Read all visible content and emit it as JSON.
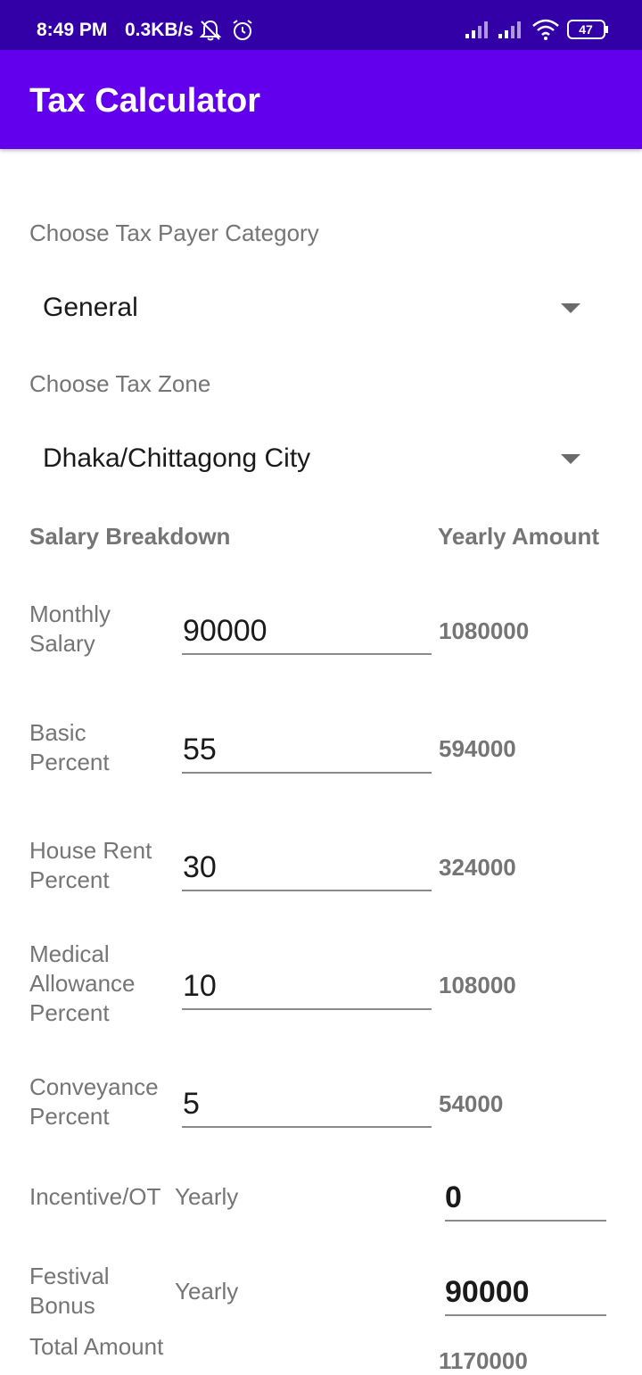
{
  "status_bar": {
    "time": "8:49 PM",
    "speed": "0.3KB/s",
    "battery": "47",
    "icons": [
      "dnd-bell-off-icon",
      "alarm-icon",
      "signal-icon",
      "signal-icon",
      "wifi-icon",
      "battery-icon"
    ]
  },
  "app_bar": {
    "title": "Tax Calculator"
  },
  "category": {
    "label": "Choose Tax Payer Category",
    "value": "General"
  },
  "zone": {
    "label": "Choose Tax Zone",
    "value": "Dhaka/Chittagong City"
  },
  "headers": {
    "breakdown": "Salary Breakdown",
    "yearly": "Yearly Amount"
  },
  "rows": [
    {
      "label_line1": "Monthly",
      "label_line2": "Salary",
      "label_line3": "",
      "value": "90000",
      "yearly": "1080000"
    },
    {
      "label_line1": "Basic",
      "label_line2": "Percent",
      "label_line3": "",
      "value": "55",
      "yearly": "594000"
    },
    {
      "label_line1": "House Rent",
      "label_line2": "Percent",
      "label_line3": "",
      "value": "30",
      "yearly": "324000"
    },
    {
      "label_line1": "Medical",
      "label_line2": "Allowance",
      "label_line3": "Percent",
      "value": "10",
      "yearly": "108000"
    },
    {
      "label_line1": "Conveyance",
      "label_line2": "Percent",
      "label_line3": "",
      "value": "5",
      "yearly": "54000"
    }
  ],
  "incentive": {
    "label": "Incentive/OT",
    "period": "Yearly",
    "value": "0"
  },
  "bonus": {
    "label_line1": "Festival",
    "label_line2": "Bonus",
    "period": "Yearly",
    "value": "90000"
  },
  "total": {
    "label": "Total Amount",
    "value": "1170000"
  },
  "colors": {
    "status_bar": "#3300a8",
    "app_bar": "#6200ee",
    "label_text": "#757575"
  }
}
